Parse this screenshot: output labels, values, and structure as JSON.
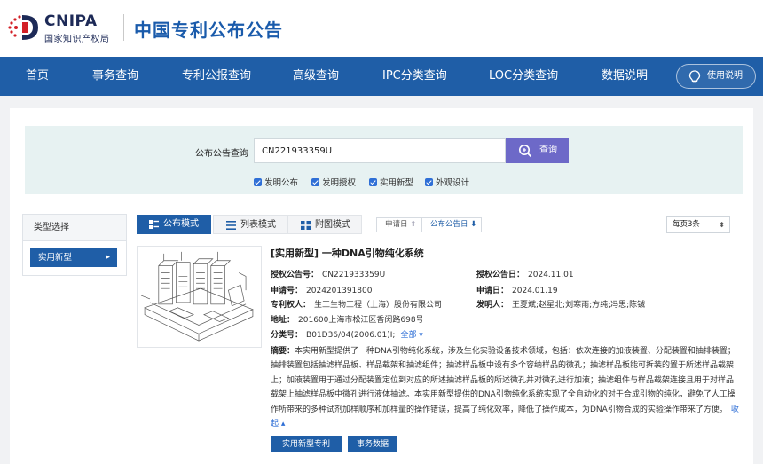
{
  "header": {
    "logo_text": "CNIPA",
    "logo_subtitle": "国家知识产权局",
    "site_title": "中国专利公布公告"
  },
  "nav": {
    "items": [
      "首页",
      "事务查询",
      "专利公报查询",
      "高级查询",
      "IPC分类查询",
      "LOC分类查询",
      "数据说明"
    ],
    "help_label": "使用说明"
  },
  "search": {
    "label": "公布公告查询",
    "value": "CN221933359U",
    "button_label": "查询",
    "checkboxes": [
      {
        "label": "发明公布",
        "checked": true
      },
      {
        "label": "发明授权",
        "checked": true
      },
      {
        "label": "实用新型",
        "checked": true
      },
      {
        "label": "外观设计",
        "checked": true
      }
    ]
  },
  "sidebar": {
    "title": "类型选择",
    "active_item": "实用新型"
  },
  "toolbar": {
    "tabs": [
      "公布模式",
      "列表模式",
      "附图模式"
    ],
    "active_tab": "公布模式",
    "sort": [
      "申请日",
      "公布公告日"
    ],
    "per_page": "每页3条"
  },
  "result": {
    "type": "[实用新型]",
    "title": "一种DNA引物纯化系统",
    "fields": {
      "grant_pub_no_label": "授权公告号：",
      "grant_pub_no": "CN221933359U",
      "grant_pub_date_label": "授权公告日：",
      "grant_pub_date": "2024.11.01",
      "app_no_label": "申请号：",
      "app_no": "2024201391800",
      "app_date_label": "申请日：",
      "app_date": "2024.01.19",
      "holder_label": "专利权人：",
      "holder": "生工生物工程（上海）股份有限公司",
      "inventor_label": "发明人：",
      "inventor": "王夏斌;赵星北;刘寒雨;方纯;冯思;陈铖",
      "address_label": "地址：",
      "address": "201600上海市松江区香闵路698号",
      "class_label": "分类号：",
      "class": "B01D36/04(2006.01)I;",
      "expand_label": "全部 ▾"
    },
    "abstract_label": "摘要：",
    "abstract": "本实用新型提供了一种DNA引物纯化系统，涉及生化实验设备技术领域，包括：依次连接的加液装置、分配装置和抽排装置；抽排装置包括抽滤样品板、样品载架和抽滤组件；抽滤样品板中设有多个容纳样品的微孔；抽滤样品板能可拆装的置于所述样品载架上；加液装置用于通过分配装置定位到对应的所述抽滤样品板的所述微孔并对微孔进行加液；抽滤组件与样品载架连接且用于对样品载架上抽滤样品板中微孔进行液体抽滤。本实用新型提供的DNA引物纯化系统实现了全自动化的对于合成引物的纯化，避免了人工操作所带来的多种试剂加样顺序和加样量的操作错误，提高了纯化效率，降低了操作成本，为DNA引物合成的实验操作带来了方便。",
    "collapse_label": "收起 ▴",
    "buttons": [
      "实用新型专利",
      "事务数据"
    ]
  },
  "colors": {
    "nav_bg": "#1f5ea7",
    "search_btn": "#6d69c8",
    "title_blue": "#1a5bab"
  }
}
